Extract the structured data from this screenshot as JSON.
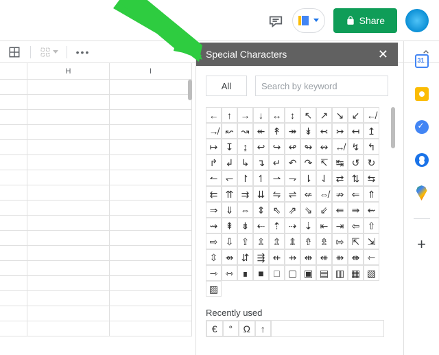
{
  "topbar": {
    "share_label": "Share"
  },
  "sheet": {
    "columns": [
      "H",
      "I"
    ]
  },
  "panel": {
    "title": "Special Characters",
    "all_tab": "All",
    "search_placeholder": "Search by keyword",
    "recently_used_label": "Recently used",
    "characters": [
      "←",
      "↑",
      "→",
      "↓",
      "↔",
      "↕",
      "↖",
      "↗",
      "↘",
      "↙",
      "↚",
      "↛",
      "↜",
      "↝",
      "↞",
      "↟",
      "↠",
      "↡",
      "↢",
      "↣",
      "↤",
      "↥",
      "↦",
      "↧",
      "↨",
      "↩",
      "↪",
      "↫",
      "↬",
      "↭",
      "↮",
      "↯",
      "↰",
      "↱",
      "↲",
      "↳",
      "↴",
      "↵",
      "↶",
      "↷",
      "↸",
      "↹",
      "↺",
      "↻",
      "↼",
      "↽",
      "↾",
      "↿",
      "⇀",
      "⇁",
      "⇂",
      "⇃",
      "⇄",
      "⇅",
      "⇆",
      "⇇",
      "⇈",
      "⇉",
      "⇊",
      "⇋",
      "⇌",
      "⇍",
      "⇎",
      "⇏",
      "⇐",
      "⇑",
      "⇒",
      "⇓",
      "⇔",
      "⇕",
      "⇖",
      "⇗",
      "⇘",
      "⇙",
      "⇚",
      "⇛",
      "⇜",
      "⇝",
      "⇞",
      "⇟",
      "⇠",
      "⇡",
      "⇢",
      "⇣",
      "⇤",
      "⇥",
      "⇦",
      "⇧",
      "⇨",
      "⇩",
      "⇪",
      "⇫",
      "⇬",
      "⇭",
      "⇮",
      "⇯",
      "⇰",
      "⇱",
      "⇲",
      "⇳",
      "⇴",
      "⇵",
      "⇶",
      "⇷",
      "⇸",
      "⇹",
      "⇺",
      "⇻",
      "⇼",
      "⇽",
      "⇾",
      "⇿",
      "∎",
      "■",
      "□",
      "▢",
      "▣",
      "▤",
      "▥",
      "▦",
      "▧",
      "▨"
    ],
    "recent": [
      "€",
      "°",
      "Ω",
      "↑"
    ]
  }
}
